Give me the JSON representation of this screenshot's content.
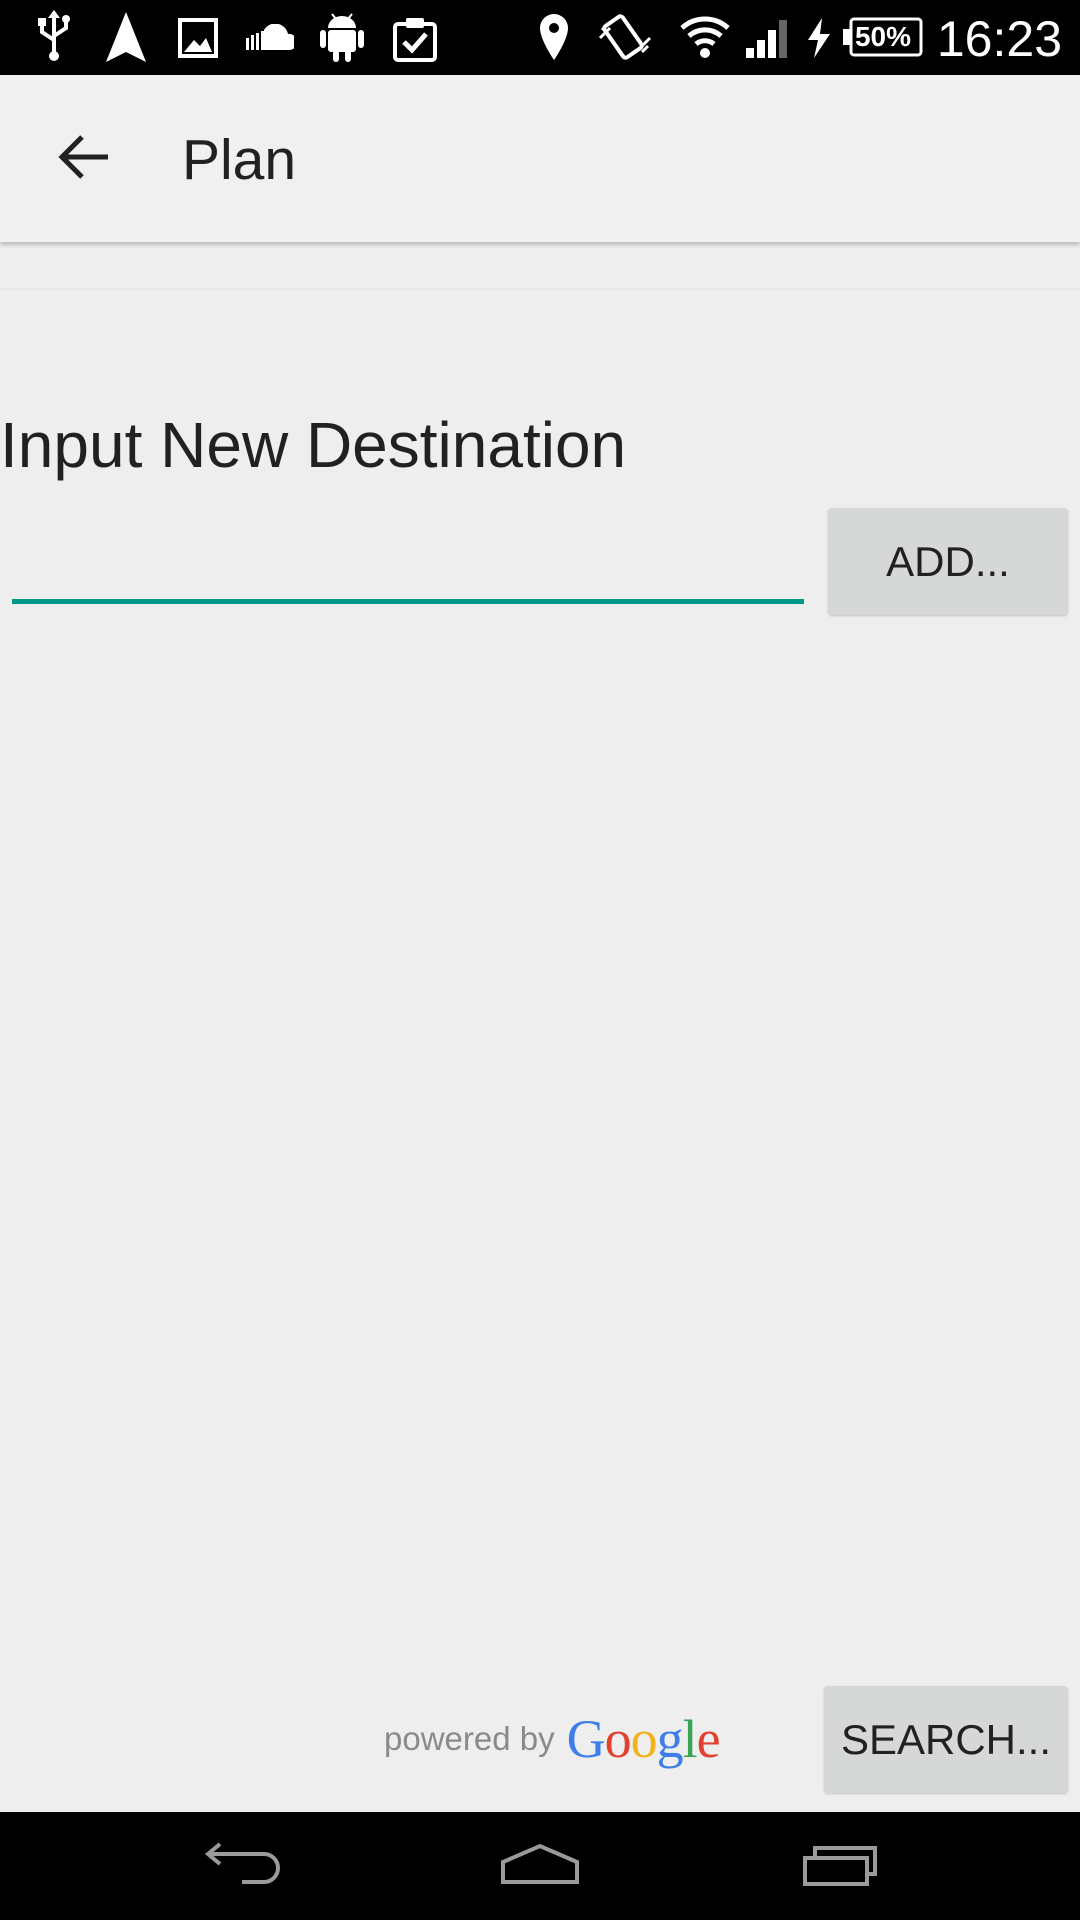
{
  "status_bar": {
    "battery_text": "50%",
    "clock": "16:23",
    "icons": [
      "usb-icon",
      "navigation-icon",
      "image-icon",
      "soundcloud-icon",
      "android-icon",
      "clipboard-check-icon",
      "location-icon",
      "vibrate-icon",
      "wifi-icon",
      "signal-icon",
      "charging-icon",
      "battery-icon"
    ]
  },
  "app_bar": {
    "title": "Plan",
    "back_icon": "arrow-back-icon"
  },
  "content": {
    "heading": "Input New Destination",
    "destination_input": {
      "value": "",
      "placeholder": ""
    },
    "add_button_label": "ADD...",
    "search_button_label": "SEARCH..."
  },
  "attribution": {
    "powered_by": "powered by",
    "brand_letters": [
      "G",
      "o",
      "o",
      "g",
      "l",
      "e"
    ]
  },
  "nav_bar": {
    "back_icon": "nav-back-icon",
    "home_icon": "nav-home-icon",
    "recents_icon": "nav-recents-icon"
  },
  "colors": {
    "accent": "#009688",
    "background": "#eeeeee",
    "app_bar": "#f0f0f0",
    "button": "#d6d7d7",
    "google_blue": "#3f7de8",
    "google_red": "#e2412f",
    "google_yellow": "#f2b21b",
    "google_green": "#3ba356"
  }
}
